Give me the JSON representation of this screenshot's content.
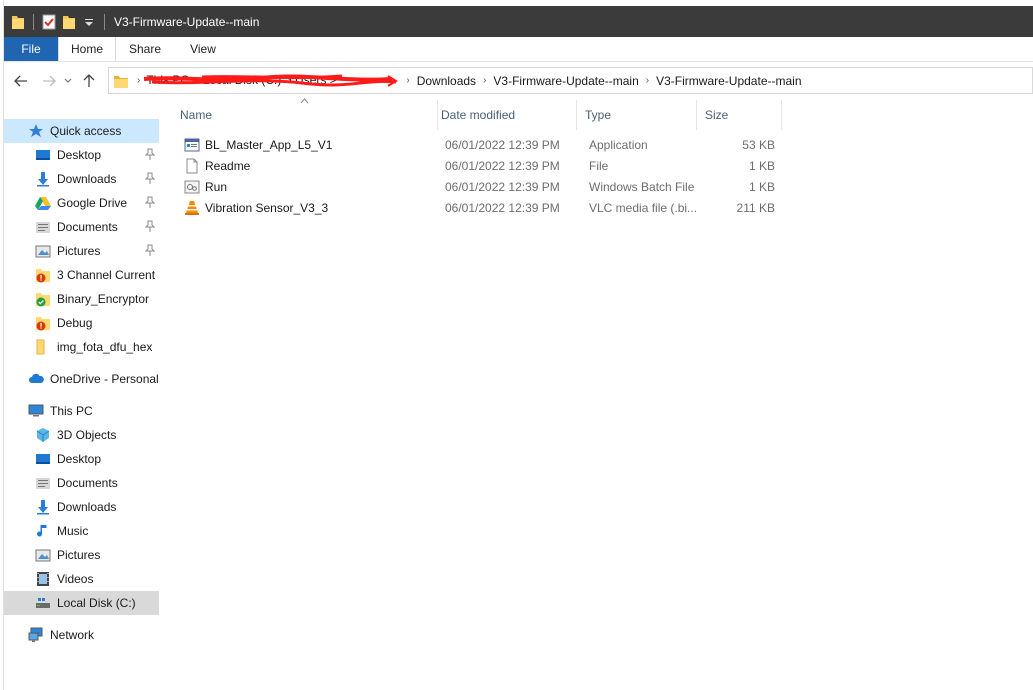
{
  "window": {
    "title": "V3-Firmware-Update--main"
  },
  "ribbon": {
    "tabs": [
      "File",
      "Home",
      "Share",
      "View"
    ]
  },
  "address": {
    "redacted_prefix": "This PC > Local Disk (C:) > Users >",
    "crumbs": [
      "Downloads",
      "V3-Firmware-Update--main",
      "V3-Firmware-Update--main"
    ]
  },
  "columns": {
    "name": "Name",
    "date": "Date modified",
    "type": "Type",
    "size": "Size"
  },
  "files": [
    {
      "name": "BL_Master_App_L5_V1",
      "date": "06/01/2022 12:39 PM",
      "type": "Application",
      "size": "53 KB",
      "icon": "application-icon"
    },
    {
      "name": "Readme",
      "date": "06/01/2022 12:39 PM",
      "type": "File",
      "size": "1 KB",
      "icon": "file-icon"
    },
    {
      "name": "Run",
      "date": "06/01/2022 12:39 PM",
      "type": "Windows Batch File",
      "size": "1 KB",
      "icon": "batch-file-icon"
    },
    {
      "name": "Vibration Sensor_V3_3",
      "date": "06/01/2022 12:39 PM",
      "type": "VLC media file (.bi...",
      "size": "211 KB",
      "icon": "vlc-icon"
    }
  ],
  "sidebar": {
    "quick_access": "Quick access",
    "quick_items": [
      {
        "label": "Desktop",
        "icon": "desktop-icon",
        "pinned": true
      },
      {
        "label": "Downloads",
        "icon": "downloads-icon",
        "pinned": true
      },
      {
        "label": "Google Drive",
        "icon": "google-drive-icon",
        "pinned": true
      },
      {
        "label": "Documents",
        "icon": "documents-icon",
        "pinned": true
      },
      {
        "label": "Pictures",
        "icon": "pictures-icon",
        "pinned": true
      },
      {
        "label": "3 Channel Current",
        "icon": "folder-error-icon",
        "pinned": false
      },
      {
        "label": "Binary_Encryptor",
        "icon": "folder-synced-icon",
        "pinned": false
      },
      {
        "label": "Debug",
        "icon": "folder-error-icon",
        "pinned": false
      },
      {
        "label": "img_fota_dfu_hex",
        "icon": "folder-icon",
        "pinned": false
      }
    ],
    "onedrive": "OneDrive - Personal",
    "this_pc": "This PC",
    "pc_items": [
      {
        "label": "3D Objects",
        "icon": "3d-objects-icon"
      },
      {
        "label": "Desktop",
        "icon": "desktop-icon"
      },
      {
        "label": "Documents",
        "icon": "documents-icon"
      },
      {
        "label": "Downloads",
        "icon": "downloads-icon"
      },
      {
        "label": "Music",
        "icon": "music-icon"
      },
      {
        "label": "Pictures",
        "icon": "pictures-icon"
      },
      {
        "label": "Videos",
        "icon": "videos-icon"
      },
      {
        "label": "Local Disk (C:)",
        "icon": "local-disk-icon"
      }
    ],
    "network": "Network"
  },
  "colors": {
    "titlebar": "#3b3b3b",
    "file_tab": "#1f65b1",
    "selected": "#cce8ff",
    "highlight": "#d9d9d9",
    "redaction": "#ff0000"
  }
}
